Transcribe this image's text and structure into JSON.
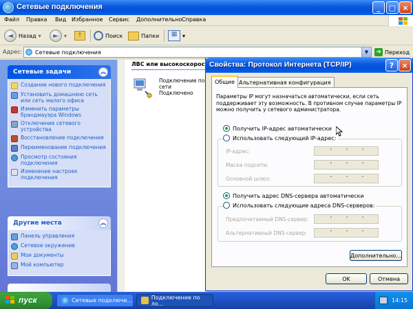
{
  "window": {
    "title": "Сетевые подключения",
    "menu": [
      "Файл",
      "Правка",
      "Вид",
      "Избранное",
      "Сервис",
      "Дополнительно",
      "Справка"
    ]
  },
  "toolbar": {
    "back": "Назад",
    "search": "Поиск",
    "folders": "Папки"
  },
  "address": {
    "label": "Адрес:",
    "value": "Сетевые подключения",
    "go": "Переход"
  },
  "sidebar": {
    "network_tasks": {
      "title": "Сетевые задачи",
      "items": [
        "Создание нового подключения",
        "Установить домашнюю сеть или сеть малого офиса",
        "Изменить параметры брандмауэра Windows",
        "Отключение сетевого устройства",
        "Восстановление подключения",
        "Переименование подключения",
        "Просмотр состояния подключения",
        "Изменение настроек подключения"
      ]
    },
    "other_places": {
      "title": "Другие места",
      "items": [
        "Панель управления",
        "Сетевое окружение",
        "Мои документы",
        "Мой компьютер"
      ]
    }
  },
  "content": {
    "group_header": "ЛВС или высокоскоростной Интернет",
    "connection": [
      "Подключение по локальной",
      "сети",
      "Подключено"
    ]
  },
  "dialog": {
    "title": "Свойства: Протокол Интернета (TCP/IP)",
    "tabs": [
      "Общие",
      "Альтернативная конфигурация"
    ],
    "description": "Параметры IP могут назначаться автоматически, если сеть поддерживает эту возможность. В противном случае параметры IP можно получить у сетевого администратора.",
    "ip_auto": "Получить IP-адрес автоматически",
    "ip_manual": "Использовать следующий IP-адрес:",
    "ip_fields": [
      "IP-адрес:",
      "Маска подсети:",
      "Основной шлюз:"
    ],
    "dns_auto": "Получить адрес DNS-сервера автоматически",
    "dns_manual": "Использовать следующие адреса DNS-серверов:",
    "dns_fields": [
      "Предпочитаемый DNS-сервер:",
      "Альтернативный DNS-сервер:"
    ],
    "advanced": "Дополнительно...",
    "ok": "OK",
    "cancel": "Отмена"
  },
  "taskbar": {
    "start": "пуск",
    "tasks": [
      "Сетевые подключе...",
      "Подключение по ло..."
    ],
    "clock": "14:15"
  }
}
